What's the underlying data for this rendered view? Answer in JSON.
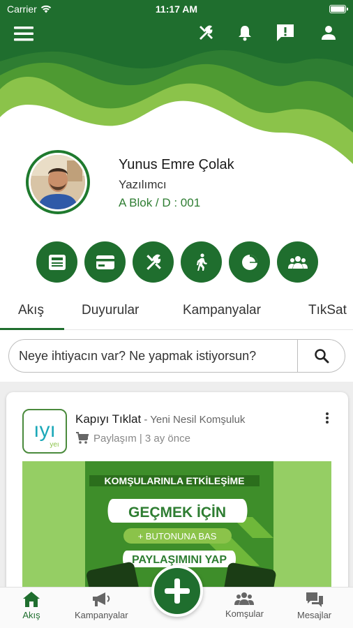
{
  "status_bar": {
    "carrier": "Carrier",
    "time": "11:17 AM"
  },
  "top_bar": {
    "icons": [
      "menu-icon",
      "tools-icon",
      "bell-icon",
      "feedback-icon",
      "person-icon"
    ]
  },
  "colors": {
    "primary": "#1f6e2e",
    "accent_light": "#8bc34a",
    "text_green": "#2e7d32"
  },
  "profile": {
    "name": "Yunus Emre Çolak",
    "role": "Yazılımcı",
    "block": "A Blok / D : 001"
  },
  "quick_actions": [
    "newspaper-icon",
    "card-icon",
    "tools-icon",
    "walk-icon",
    "pie-chart-icon",
    "group-icon"
  ],
  "tabs": [
    "Akış",
    "Duyurular",
    "Kampanyalar",
    "TıkSat"
  ],
  "active_tab": "Akış",
  "search": {
    "placeholder": "Neye ihtiyacın var? Ne yapmak istiyorsun?"
  },
  "post": {
    "logo_text": "ıyı",
    "logo_subtext": "yeı",
    "title": "Kapıyı Tıklat",
    "title_sub": " - Yeni Nesil Komşuluk",
    "meta": "Paylaşım | 3 ay önce",
    "banner": {
      "line1": "KOMŞULARINLA ETKİLEŞİME",
      "line2": "GEÇMEK İÇİN",
      "line3": "+ BUTONUNA BAS",
      "line4": "PAYLAŞIMINI YAP"
    }
  },
  "bottom_nav": {
    "feed": "Akış",
    "campaigns": "Kampanyalar",
    "neighbors": "Komşular",
    "messages": "Mesajlar"
  }
}
